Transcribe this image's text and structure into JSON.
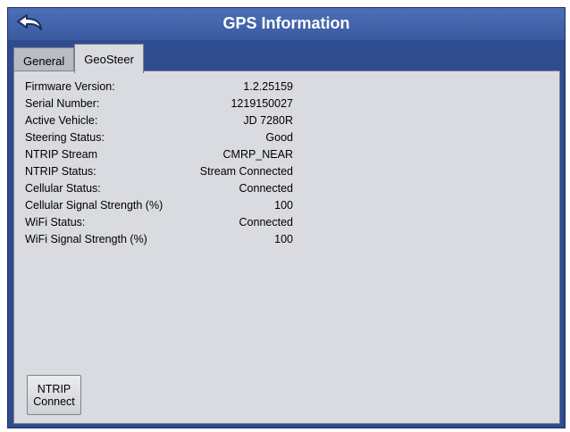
{
  "title": "GPS Information",
  "tabs": [
    {
      "label": "General",
      "active": false
    },
    {
      "label": "GeoSteer",
      "active": true
    }
  ],
  "info": [
    {
      "label": "Firmware Version:",
      "value": "1.2.25159"
    },
    {
      "label": "Serial Number:",
      "value": "1219150027"
    },
    {
      "label": "Active Vehicle:",
      "value": "JD 7280R"
    },
    {
      "label": "Steering Status:",
      "value": "Good"
    },
    {
      "label": "NTRIP Stream",
      "value": "CMRP_NEAR"
    },
    {
      "label": "NTRIP Status:",
      "value": "Stream Connected"
    },
    {
      "label": "Cellular Status:",
      "value": "Connected"
    },
    {
      "label": "Cellular Signal Strength (%)",
      "value": "100"
    },
    {
      "label": "WiFi Status:",
      "value": "Connected"
    },
    {
      "label": "WiFi Signal Strength (%)",
      "value": "100"
    }
  ],
  "buttons": {
    "ntrip_connect_line1": "NTRIP",
    "ntrip_connect_line2": "Connect"
  },
  "icons": {
    "back": "back-arrow-icon"
  },
  "colors": {
    "titlebar": "#3a5aa0",
    "panel": "#d9dbe0",
    "frame": "#2f4c8f"
  }
}
